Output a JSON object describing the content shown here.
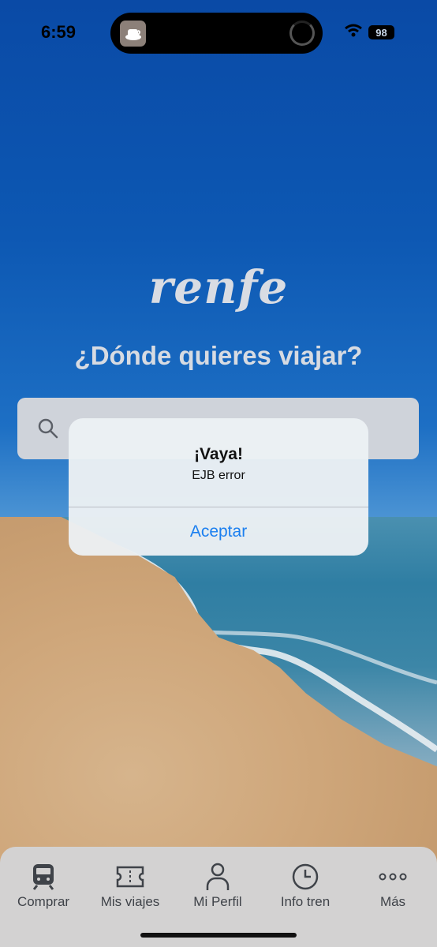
{
  "status_bar": {
    "time": "6:59",
    "battery": "98"
  },
  "brand": {
    "logo_text": "renfe"
  },
  "home": {
    "question": "¿Dónde quieres viajar?",
    "search": {
      "placeholder": "",
      "value": ""
    }
  },
  "alert": {
    "title": "¡Vaya!",
    "message": "EJB error",
    "button_label": "Aceptar"
  },
  "tabbar": {
    "items": [
      {
        "label": "Comprar",
        "icon": "train-icon"
      },
      {
        "label": "Mis viajes",
        "icon": "ticket-icon"
      },
      {
        "label": "Mi Perfil",
        "icon": "person-icon"
      },
      {
        "label": "Info tren",
        "icon": "clock-icon"
      },
      {
        "label": "Más",
        "icon": "more-icon"
      }
    ]
  },
  "colors": {
    "accent": "#1b7ff0",
    "sky_top": "#0a4aa6",
    "tabbar_bg": "#d3d2d2"
  }
}
